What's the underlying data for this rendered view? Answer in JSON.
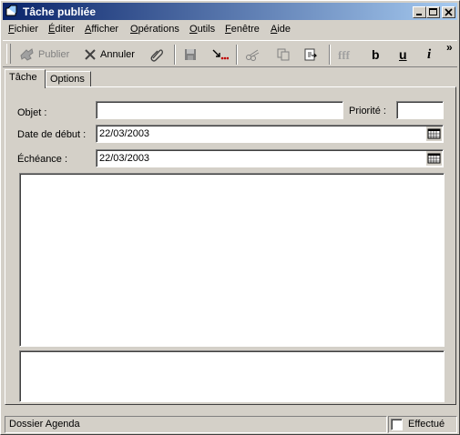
{
  "window": {
    "title": "Tâche publiée"
  },
  "menu": [
    {
      "label": "Fichier",
      "u": "F",
      "rest": "ichier"
    },
    {
      "label": "Éditer",
      "u": "É",
      "rest": "diter"
    },
    {
      "label": "Afficher",
      "u": "A",
      "rest": "fficher"
    },
    {
      "label": "Opérations",
      "u": "O",
      "rest": "pérations"
    },
    {
      "label": "Outils",
      "u": "O",
      "rest": "utils"
    },
    {
      "label": "Fenêtre",
      "u": "F",
      "rest": "enêtre"
    },
    {
      "label": "Aide",
      "u": "A",
      "rest": "ide"
    }
  ],
  "toolbar": {
    "publish_label": "Publier",
    "cancel_label": "Annuler",
    "overflow": "»",
    "bold": "b",
    "underline": "u",
    "italic": "i"
  },
  "tabs": {
    "task": "Tâche",
    "options": "Options"
  },
  "form": {
    "subject_label": "Objet :",
    "subject_value": "",
    "priority_label": "Priorité :",
    "priority_value": "",
    "start_label": "Date de début :",
    "start_value": "22/03/2003",
    "due_label": "Échéance :",
    "due_value": "22/03/2003"
  },
  "status": {
    "folder": "Dossier Agenda",
    "done_label": "Effectué",
    "done_checked": false
  }
}
